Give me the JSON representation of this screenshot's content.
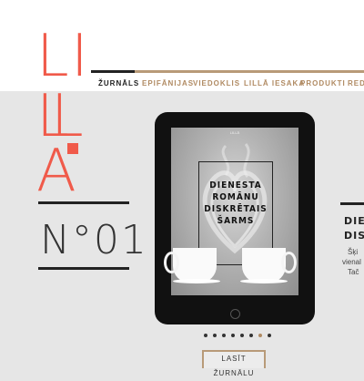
{
  "brand": {
    "letters": [
      "L",
      "I",
      "L",
      "L",
      "A"
    ],
    "accent": "#f05a4a"
  },
  "nav": {
    "items": [
      {
        "label": "ŽURNĀLS",
        "active": true
      },
      {
        "label": "EPIFĀNIJAS"
      },
      {
        "label": "VIEDOKLIS"
      },
      {
        "label": "LILLĀ IESAKA"
      },
      {
        "label": "PRODUKTI"
      },
      {
        "label": "REDA"
      }
    ],
    "active_color": "#222222",
    "inactive_color": "#b08a62"
  },
  "issue": {
    "number": "N°01"
  },
  "cover": {
    "lines": [
      "DIENESTA",
      "ROMĀNU",
      "DISKRĒTAIS",
      "ŠARMS"
    ],
    "header_tiny": "LILLĀ"
  },
  "carousel": {
    "total": 8,
    "active_index": 6
  },
  "cta": {
    "read_label": "LASĪT ŽURNĀLU"
  },
  "side_article": {
    "title_lines": [
      "DIE",
      "DIS"
    ],
    "text_lines": [
      "Šķi",
      "vienal",
      "Tač"
    ]
  }
}
